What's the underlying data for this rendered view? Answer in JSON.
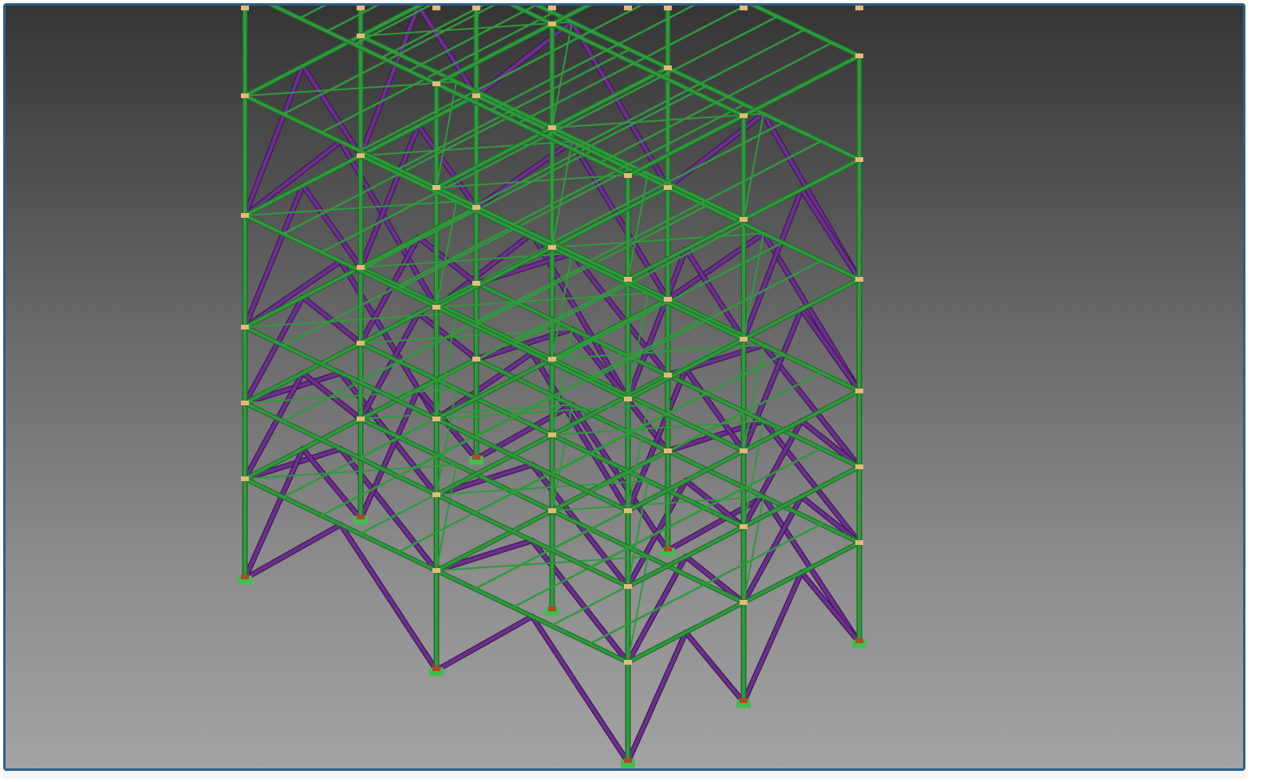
{
  "viewport": {
    "background_top": "#353535",
    "background_bottom": "#a3a3a3",
    "frame_border": "#2f5f86"
  },
  "model": {
    "view": "isometric",
    "structure": "steel-frame-tower",
    "levels": 5,
    "member_colors": {
      "beams_columns": "#2f9a3c",
      "bracing": "#6b2f8c",
      "connections": "#e8b87a",
      "supports": "#b8432b"
    }
  }
}
